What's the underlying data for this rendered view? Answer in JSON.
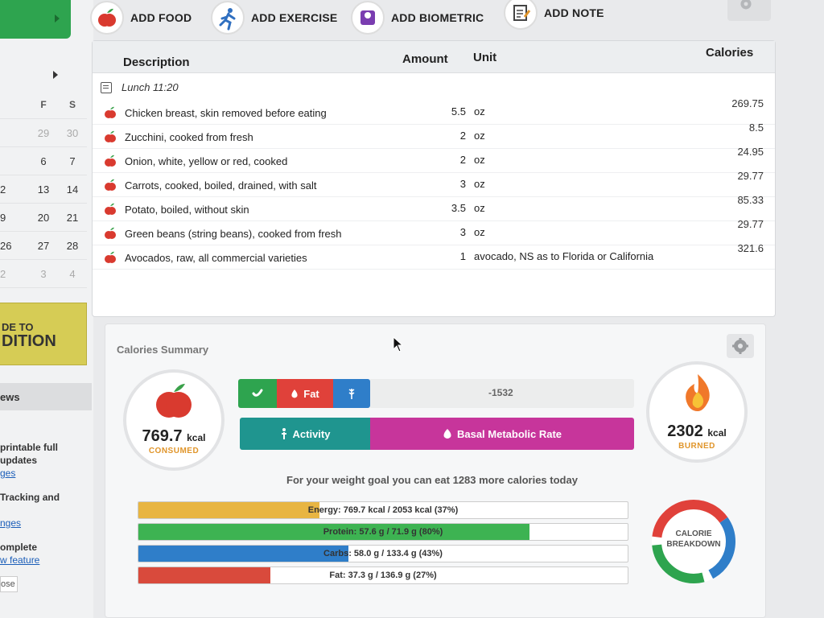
{
  "toolbar": {
    "items": [
      {
        "label": "ADD FOOD",
        "icon": "apple-icon"
      },
      {
        "label": "ADD EXERCISE",
        "icon": "running-icon"
      },
      {
        "label": "ADD BIOMETRIC",
        "icon": "scale-icon"
      },
      {
        "label": "ADD NOTE",
        "icon": "note-icon"
      }
    ]
  },
  "sidebar": {
    "calendar": {
      "headers": [
        "F",
        "S"
      ],
      "rows": [
        [
          "",
          "29",
          "30"
        ],
        [
          "",
          "6",
          "7"
        ],
        [
          "2",
          "13",
          "14"
        ],
        [
          "9",
          "20",
          "21"
        ],
        [
          "26",
          "27",
          "28"
        ],
        [
          "2",
          "3",
          "4"
        ]
      ]
    },
    "promo": {
      "line1": "DE TO",
      "line2": "DITION"
    },
    "news": {
      "title": "ews",
      "lines": [
        "printable full",
        "updates",
        "ges",
        "Tracking and",
        "nges",
        "omplete",
        "w feature",
        "ose"
      ]
    }
  },
  "table": {
    "headers": {
      "description": "Description",
      "amount": "Amount",
      "unit": "Unit",
      "calories": "Calories"
    },
    "meal": "Lunch 11:20",
    "rows": [
      {
        "description": "Chicken breast, skin removed before eating",
        "amount": "5.5",
        "unit": "oz",
        "calories": "269.75"
      },
      {
        "description": "Zucchini, cooked from fresh",
        "amount": "2",
        "unit": "oz",
        "calories": "8.5"
      },
      {
        "description": "Onion, white, yellow or red, cooked",
        "amount": "2",
        "unit": "oz",
        "calories": "24.95"
      },
      {
        "description": "Carrots, cooked, boiled, drained, with salt",
        "amount": "3",
        "unit": "oz",
        "calories": "29.77"
      },
      {
        "description": "Potato, boiled, without skin",
        "amount": "3.5",
        "unit": "oz",
        "calories": "85.33"
      },
      {
        "description": "Green beans (string beans), cooked from fresh",
        "amount": "3",
        "unit": "oz",
        "calories": "29.77"
      },
      {
        "description": "Avocados, raw, all commercial varieties",
        "amount": "1",
        "unit": "avocado, NS as to Florida or California",
        "calories": "321.6"
      }
    ]
  },
  "summary": {
    "title": "Calories Summary",
    "consumed": {
      "value": "769.7",
      "unit": "kcal",
      "label": "CONSUMED"
    },
    "burned": {
      "value": "2302",
      "unit": "kcal",
      "label": "BURNED"
    },
    "macros": {
      "fat_label": "Fat"
    },
    "deficit": "-1532",
    "burn": {
      "activity_label": "Activity",
      "bmr_label": "Basal Metabolic Rate"
    },
    "goal_text": "For your weight goal you can eat 1283 more calories today",
    "targets": [
      {
        "label": "Energy: 769.7 kcal / 2053 kcal (37%)",
        "fraction": 0.37,
        "color": "#e8b542"
      },
      {
        "label": "Protein: 57.6 g / 71.9 g (80%)",
        "fraction": 0.8,
        "color": "#3db352"
      },
      {
        "label": "Carbs: 58.0 g / 133.4 g (43%)",
        "fraction": 0.43,
        "color": "#2f7ec9"
      },
      {
        "label": "Fat: 37.3 g / 136.9 g (27%)",
        "fraction": 0.27,
        "color": "#d94a3c"
      }
    ],
    "breakdown": {
      "line1": "CALORIE",
      "line2": "BREAKDOWN"
    }
  },
  "colors": {
    "green": "#2ea44f",
    "red": "#e0413a",
    "blue": "#2f7ec9",
    "teal": "#1f958f",
    "magenta": "#c7359b",
    "orange": "#e0952a"
  }
}
